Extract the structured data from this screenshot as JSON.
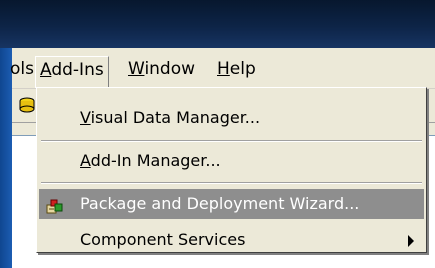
{
  "menubar": {
    "items": [
      {
        "label": "ols",
        "underline": ""
      },
      {
        "label_u": "A",
        "label_rest": "dd-Ins"
      },
      {
        "label_u": "W",
        "label_rest": "indow"
      },
      {
        "label_u": "H",
        "label_rest": "elp"
      }
    ]
  },
  "dropdown": {
    "items": [
      {
        "label_u": "V",
        "label_rest": "isual Data Manager...",
        "highlighted": false
      },
      {
        "label_u": "A",
        "label_rest": "dd-In Manager...",
        "highlighted": false
      },
      {
        "label": "Package and Deployment Wizard...",
        "highlighted": true,
        "icon": "package-wizard-icon"
      },
      {
        "label": "Component Services",
        "highlighted": false,
        "submenu": true,
        "arrow_icon": "submenu-arrow-icon"
      }
    ]
  },
  "toolbar": {
    "icon": "data-manager-icon"
  },
  "colors": {
    "title_bar": "#0d2447",
    "left_edge": "#1c5db2",
    "menu_bg": "#ece9d8",
    "highlight": "#8e8e8e"
  }
}
